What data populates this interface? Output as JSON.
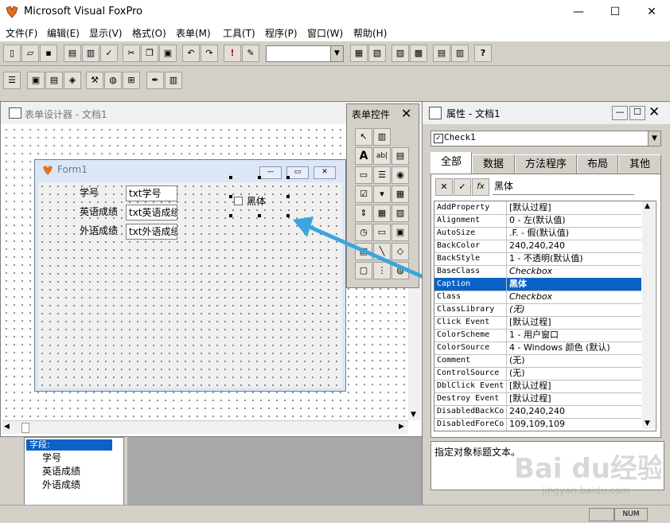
{
  "app": {
    "title": "Microsoft Visual FoxPro",
    "controls": {
      "minimize": "—",
      "maximize": "☐",
      "close": "✕"
    }
  },
  "menu": [
    "文件(F)",
    "编辑(E)",
    "显示(V)",
    "格式(O)",
    "表单(M)",
    "工具(T)",
    "程序(P)",
    "窗口(W)",
    "帮助(H)"
  ],
  "designer": {
    "title": "表单设计器 - 文档1",
    "form": {
      "title": "Form1",
      "labels": [
        "学号",
        "英语成绩",
        "外语成绩"
      ],
      "textboxes": [
        "txt学号",
        "txt英语成绩",
        "txt外语成绩"
      ],
      "checkbox": "黑体"
    }
  },
  "toolbox": {
    "title": "表单控件",
    "close": "✕"
  },
  "properties": {
    "title": "属性 - 文档1",
    "object": "Check1",
    "tabs": [
      "全部",
      "数据",
      "方法程序",
      "布局",
      "其他"
    ],
    "active_tab": 0,
    "edit_value": "黑体",
    "rows": [
      {
        "name": "AddProperty",
        "value": "[默认过程]",
        "italic": false
      },
      {
        "name": "Alignment",
        "value": "0 - 左(默认值)",
        "italic": false
      },
      {
        "name": "AutoSize",
        "value": ".F. - 假(默认值)",
        "italic": false
      },
      {
        "name": "BackColor",
        "value": "240,240,240",
        "italic": false
      },
      {
        "name": "BackStyle",
        "value": "1 - 不透明(默认值)",
        "italic": false
      },
      {
        "name": "BaseClass",
        "value": "Checkbox",
        "italic": true
      },
      {
        "name": "Caption",
        "value": "黑体",
        "italic": false
      },
      {
        "name": "Class",
        "value": "Checkbox",
        "italic": true
      },
      {
        "name": "ClassLibrary",
        "value": "(无)",
        "italic": true
      },
      {
        "name": "Click Event",
        "value": "[默认过程]",
        "italic": false
      },
      {
        "name": "ColorScheme",
        "value": "1 - 用户窗口",
        "italic": false
      },
      {
        "name": "ColorSource",
        "value": "4 - Windows 颜色 (默认)",
        "italic": false
      },
      {
        "name": "Comment",
        "value": "(无)",
        "italic": false
      },
      {
        "name": "ControlSource",
        "value": "(无)",
        "italic": false
      },
      {
        "name": "DblClick Event",
        "value": "[默认过程]",
        "italic": false
      },
      {
        "name": "Destroy Event",
        "value": "[默认过程]",
        "italic": false
      },
      {
        "name": "DisabledBackCo",
        "value": "240,240,240",
        "italic": false
      },
      {
        "name": "DisabledForeCo",
        "value": "109,109,109",
        "italic": false
      }
    ],
    "selected_row": 6,
    "description": "指定对象标题文本。"
  },
  "tree": {
    "header": "字段:",
    "items": [
      "学号",
      "英语成绩",
      "外语成绩"
    ]
  },
  "status": {
    "num": "NUM"
  },
  "watermark": "Baidu经验 jingyan.baidu.com",
  "colors": {
    "selection": "#0a62c6",
    "arrow": "#3aa6dc"
  }
}
